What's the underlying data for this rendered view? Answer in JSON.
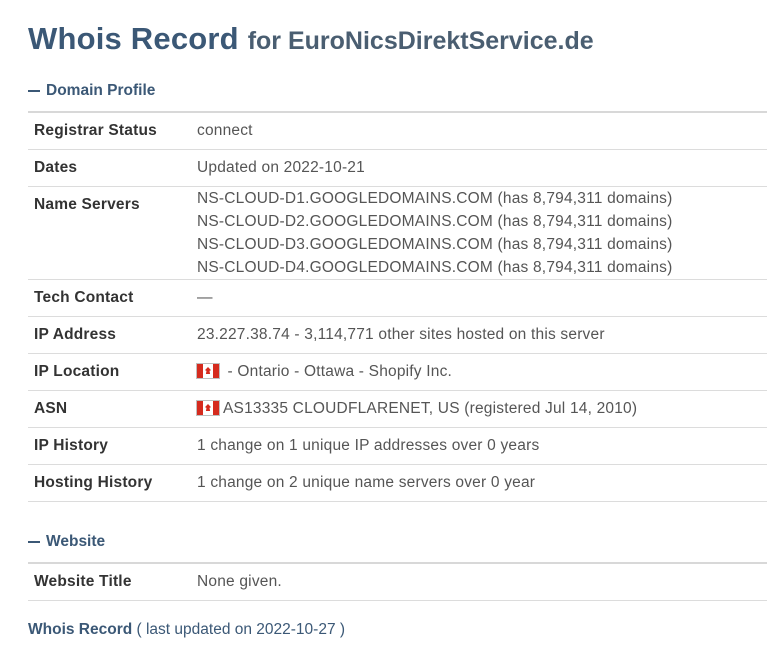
{
  "title": {
    "main": "Whois Record",
    "sub": "for EuroNicsDirektService.de"
  },
  "domain_profile": {
    "header": "Domain Profile",
    "rows": [
      {
        "label": "Registrar Status",
        "value": "connect"
      },
      {
        "label": "Dates",
        "value": "Updated on 2022-10-21"
      },
      {
        "label": "Name Servers",
        "values": [
          "NS-CLOUD-D1.GOOGLEDOMAINS.COM (has 8,794,311 domains)",
          "NS-CLOUD-D2.GOOGLEDOMAINS.COM (has 8,794,311 domains)",
          "NS-CLOUD-D3.GOOGLEDOMAINS.COM (has 8,794,311 domains)",
          "NS-CLOUD-D4.GOOGLEDOMAINS.COM (has 8,794,311 domains)"
        ]
      },
      {
        "label": "Tech Contact",
        "value": "—"
      },
      {
        "label": "IP Address",
        "value": "23.227.38.74 - 3,114,771 other sites hosted on this server"
      },
      {
        "label": "IP Location",
        "value": " - Ontario - Ottawa - Shopify Inc.",
        "flag": "canada-flag-icon"
      },
      {
        "label": "ASN",
        "value": "AS13335 CLOUDFLARENET, US (registered Jul 14, 2010)",
        "flag": "canada-flag-icon"
      },
      {
        "label": "IP History",
        "value": "1 change on 1 unique IP addresses over 0 years"
      },
      {
        "label": "Hosting History",
        "value": "1 change on 2 unique name servers over 0 year"
      }
    ]
  },
  "website": {
    "header": "Website",
    "rows": [
      {
        "label": "Website Title",
        "value": "None given."
      }
    ]
  },
  "footer": {
    "link": "Whois Record",
    "note": "( last updated on 2022-10-27 )"
  },
  "colors": {
    "heading": "#3b5876",
    "flag_red": "#d52b1e"
  }
}
